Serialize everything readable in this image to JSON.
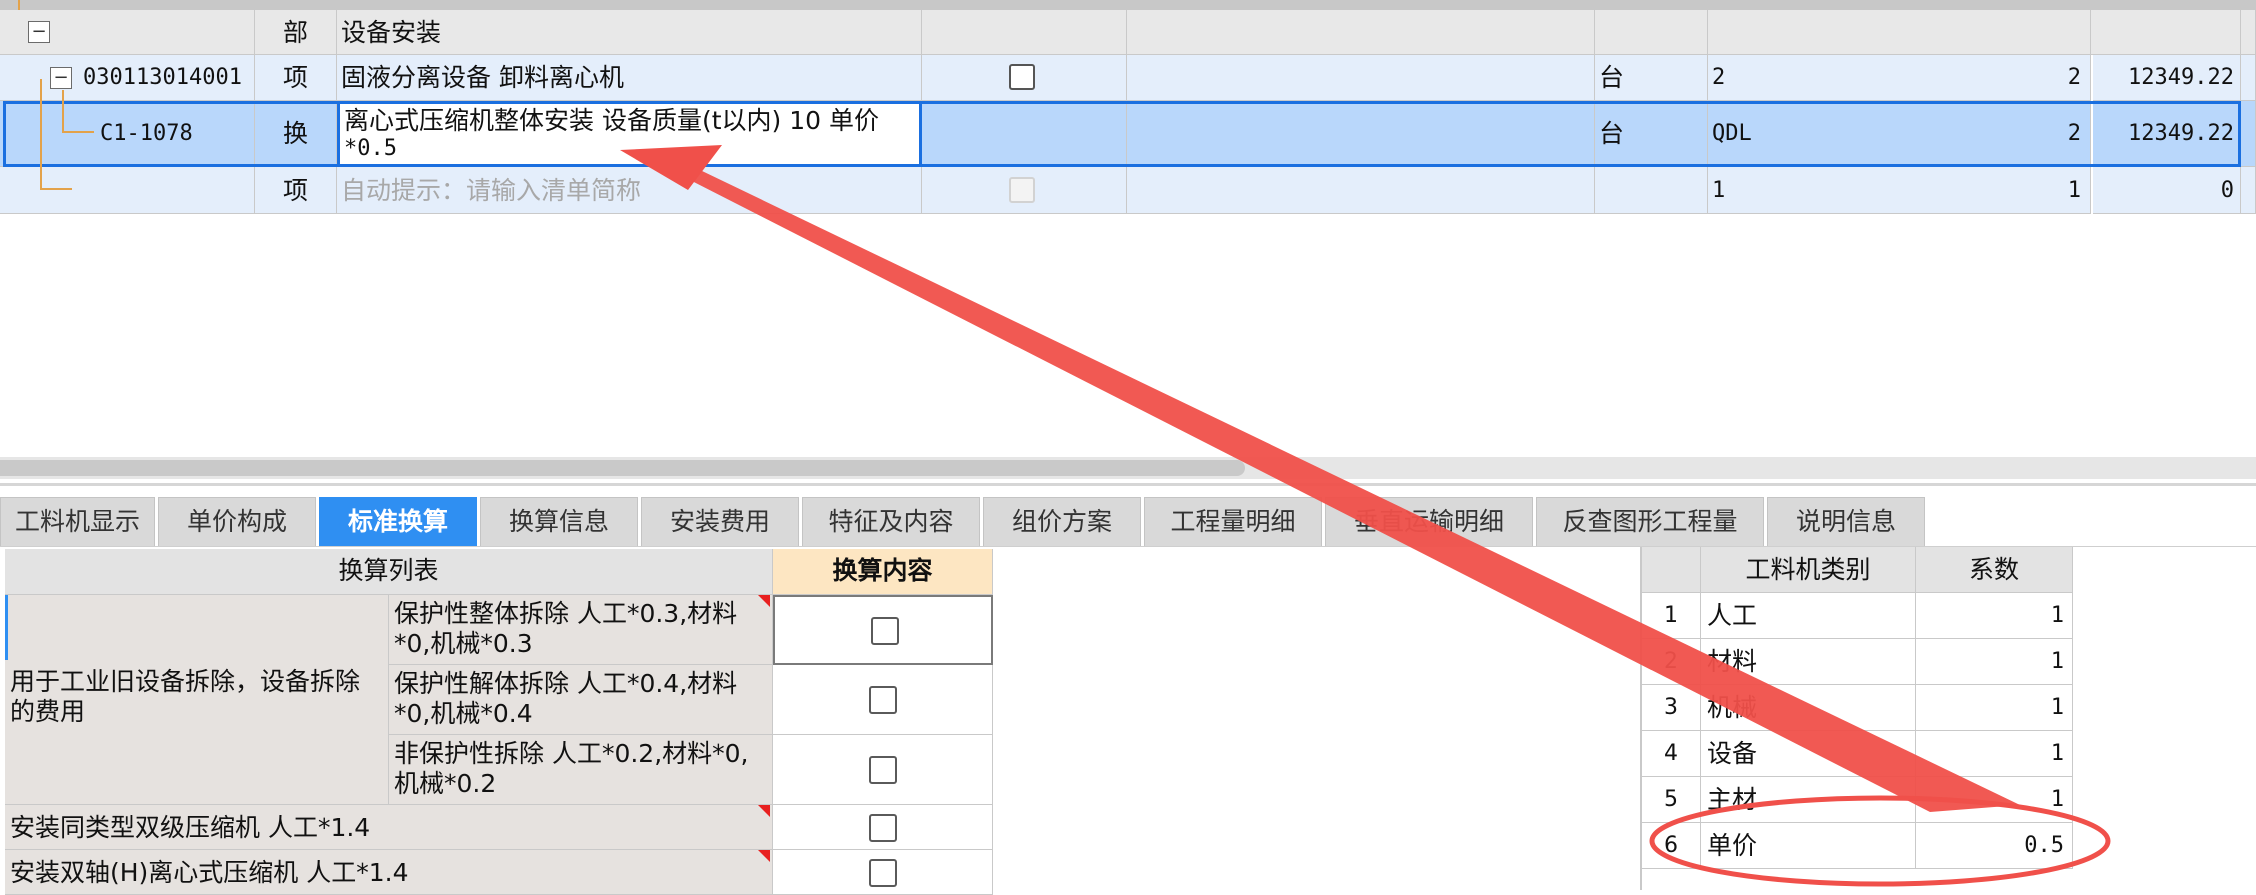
{
  "top_grid": {
    "rows": [
      {
        "code": "",
        "type": "部",
        "name": "设备安装",
        "unit": "",
        "expr": "",
        "qty": "",
        "price": ""
      },
      {
        "code": "030113014001",
        "type": "项",
        "name": "固液分离设备  卸料离心机",
        "unit": "台",
        "expr": "2",
        "qty": "2",
        "price": "12349.22"
      },
      {
        "code": "C1-1078",
        "type": "换",
        "name_line1": "离心式压缩机整体安装 设备质量(t以内) 10  单价",
        "name_line2": "*0.5",
        "unit": "台",
        "expr": "QDL",
        "qty": "2",
        "price": "12349.22"
      },
      {
        "code": "",
        "type": "项",
        "name": "自动提示：请输入清单简称",
        "unit": "",
        "expr": "1",
        "qty": "1",
        "price": "0"
      }
    ],
    "collapse_symbol": "−"
  },
  "tabs": [
    {
      "label": "工料机显示"
    },
    {
      "label": "单价构成"
    },
    {
      "label": "标准换算",
      "active": true
    },
    {
      "label": "换算信息"
    },
    {
      "label": "安装费用"
    },
    {
      "label": "特征及内容"
    },
    {
      "label": "组价方案"
    },
    {
      "label": "工程量明细"
    },
    {
      "label": "垂直运输明细"
    },
    {
      "label": "反查图形工程量"
    },
    {
      "label": "说明信息"
    }
  ],
  "conversion": {
    "header_list": "换算列表",
    "header_content": "换算内容",
    "group_label": "用于工业旧设备拆除，设备拆除的费用",
    "options": [
      "保护性整体拆除 人工*0.3,材料*0,机械*0.3",
      "保护性解体拆除 人工*0.4,材料*0,机械*0.4",
      "非保护性拆除 人工*0.2,材料*0,机械*0.2"
    ],
    "rows": [
      "安装同类型双级压缩机 人工*1.4",
      "安装双轴(H)离心式压缩机 人工*1.4"
    ]
  },
  "coefficients": {
    "header_type": "工料机类别",
    "header_coef": "系数",
    "rows": [
      {
        "idx": "1",
        "type": "人工",
        "coef": "1"
      },
      {
        "idx": "2",
        "type": "材料",
        "coef": "1"
      },
      {
        "idx": "3",
        "type": "机械",
        "coef": "1"
      },
      {
        "idx": "4",
        "type": "设备",
        "coef": "1"
      },
      {
        "idx": "5",
        "type": "主材",
        "coef": "1"
      },
      {
        "idx": "6",
        "type": "单价",
        "coef": "0.5"
      }
    ]
  },
  "annotation": {
    "arrow_color": "#f0504a",
    "ellipse_color": "#f0504a"
  },
  "colors": {
    "active_tab": "#2f8ff2",
    "selected_row": "#b9d7fb",
    "selection_border": "#1a6fe0"
  }
}
